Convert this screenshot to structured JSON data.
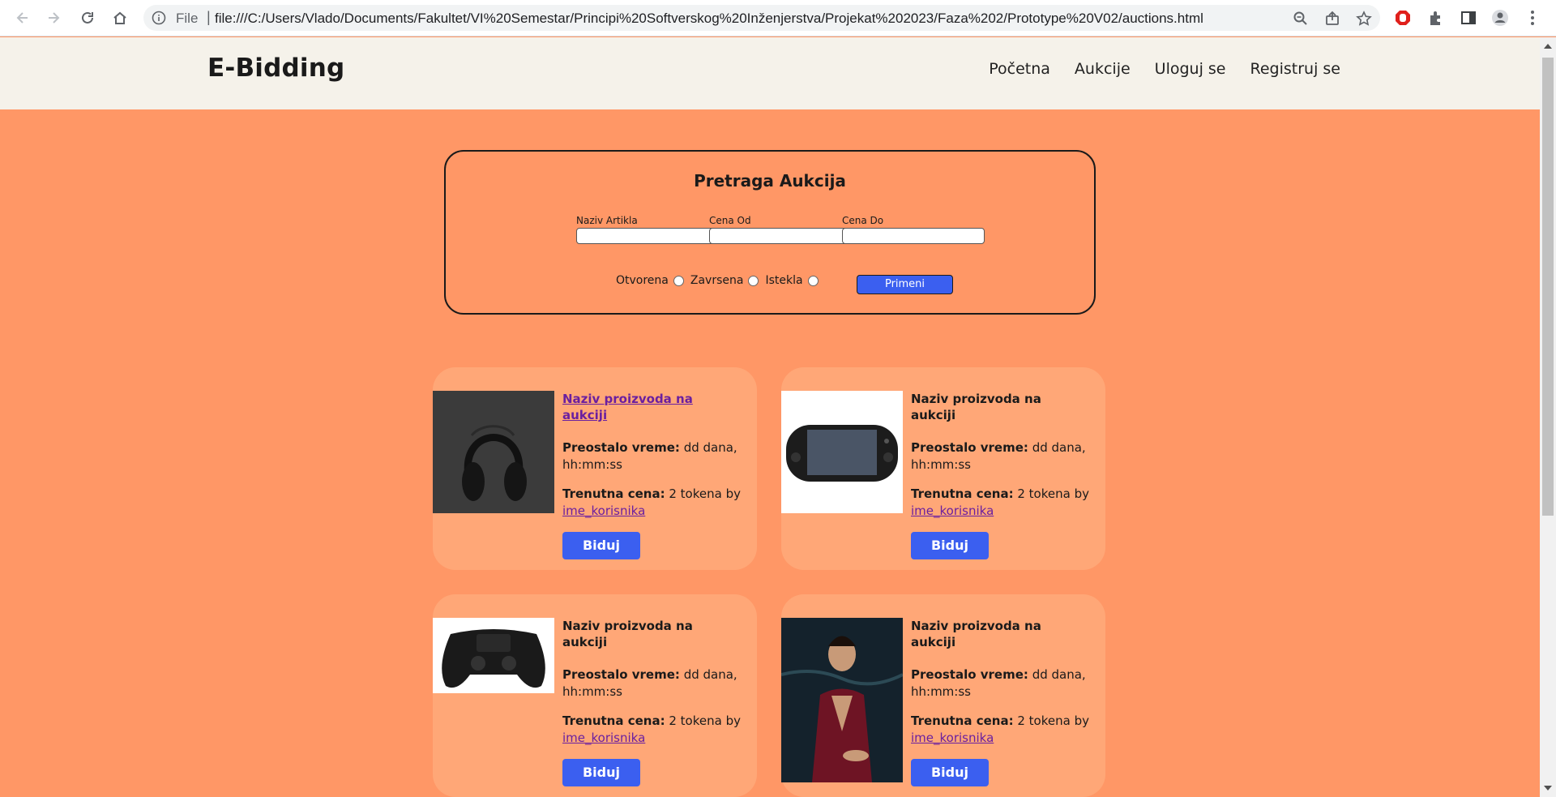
{
  "browser": {
    "scheme": "File",
    "url": "file:///C:/Users/Vlado/Documents/Fakultet/VI%20Semestar/Principi%20Softverskog%20Inženjerstva/Projekat%202023/Faza%202/Prototype%20V02/auctions.html"
  },
  "header": {
    "brand": "E-Bidding",
    "nav": [
      "Početna",
      "Aukcije",
      "Uloguj se",
      "Registruj se"
    ]
  },
  "search": {
    "title": "Pretraga Aukcija",
    "fields": [
      {
        "label": "Naziv Artikla",
        "value": ""
      },
      {
        "label": "Cena Od",
        "value": ""
      },
      {
        "label": "Cena Do",
        "value": ""
      }
    ],
    "statuses": [
      "Otvorena",
      "Zavrsena",
      "Istekla"
    ],
    "apply_label": "Primeni"
  },
  "auctions": [
    {
      "name": "Naziv proizvoda na aukciji",
      "time_label": "Preostalo vreme:",
      "time_value": "dd dana, hh:mm:ss",
      "price_label": "Trenutna cena:",
      "price_value": "2 tokena by",
      "user": "ime_korisnika",
      "bid_label": "Biduj",
      "image": "headphones"
    },
    {
      "name": "Naziv proizvoda na aukciji",
      "time_label": "Preostalo vreme:",
      "time_value": "dd dana, hh:mm:ss",
      "price_label": "Trenutna cena:",
      "price_value": "2 tokena by",
      "user": "ime_korisnika",
      "bid_label": "Biduj",
      "image": "handheld-console"
    },
    {
      "name": "Naziv proizvoda na aukciji",
      "time_label": "Preostalo vreme:",
      "time_value": "dd dana, hh:mm:ss",
      "price_label": "Trenutna cena:",
      "price_value": "2 tokena by",
      "user": "ime_korisnika",
      "bid_label": "Biduj",
      "image": "gamepad"
    },
    {
      "name": "Naziv proizvoda na aukciji",
      "time_label": "Preostalo vreme:",
      "time_value": "dd dana, hh:mm:ss",
      "price_label": "Trenutna cena:",
      "price_value": "2 tokena by",
      "user": "ime_korisnika",
      "bid_label": "Biduj",
      "image": "portrait-painting"
    }
  ],
  "colors": {
    "page_bg": "#ff9766",
    "header_bg": "#f5f2ea",
    "card_bg": "#ffa777",
    "accent": "#3b5ff0",
    "link_visited": "#6a1fa0"
  }
}
